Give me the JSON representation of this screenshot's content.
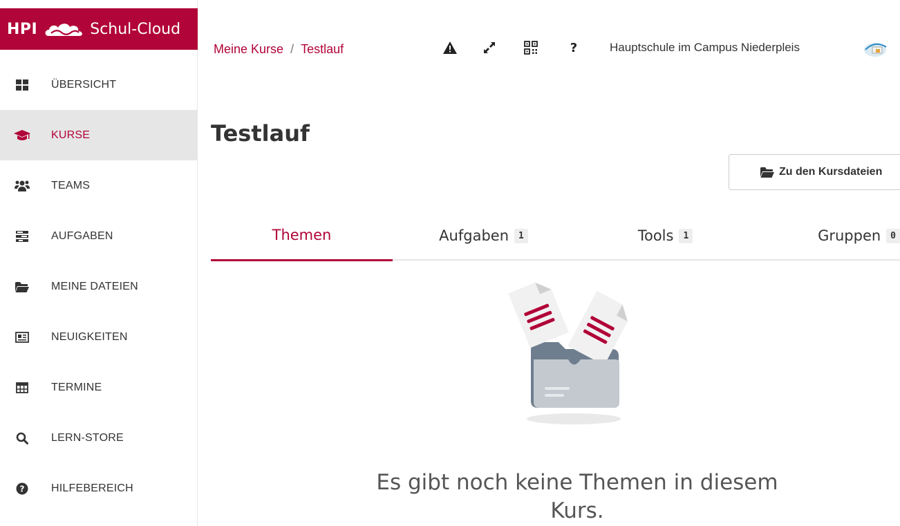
{
  "logo": {
    "hpi": "HPI",
    "brand": "Schul-Cloud"
  },
  "sidebar": {
    "items": [
      {
        "label": "ÜBERSICHT",
        "icon": "dashboard-icon"
      },
      {
        "label": "KURSE",
        "icon": "graduation-cap-icon",
        "active": true
      },
      {
        "label": "TEAMS",
        "icon": "users-icon"
      },
      {
        "label": "AUFGABEN",
        "icon": "tasks-icon"
      },
      {
        "label": "MEINE DATEIEN",
        "icon": "folder-open-icon"
      },
      {
        "label": "NEUIGKEITEN",
        "icon": "newspaper-icon"
      },
      {
        "label": "TERMINE",
        "icon": "calendar-table-icon"
      },
      {
        "label": "LERN-STORE",
        "icon": "search-icon"
      },
      {
        "label": "HILFEBEREICH",
        "icon": "question-circle-icon"
      }
    ]
  },
  "breadcrumb": {
    "parent": "Meine Kurse",
    "separator": "/",
    "current": "Testlauf"
  },
  "topbar": {
    "school_name": "Hauptschule im Campus Niederpleis",
    "icons": [
      "warning-icon",
      "fullscreen-icon",
      "qr-code-icon",
      "help-icon"
    ]
  },
  "main": {
    "title": "Testlauf",
    "files_button": "Zu den Kursdateien",
    "tabs": [
      {
        "label": "Themen",
        "active": true
      },
      {
        "label": "Aufgaben",
        "count": "1"
      },
      {
        "label": "Tools",
        "count": "1"
      },
      {
        "label": "Gruppen",
        "count": "0"
      }
    ],
    "empty_text": "Es gibt noch keine Themen in diesem Kurs."
  },
  "colors": {
    "accent": "#b10438",
    "active_bg": "#e6e6e6",
    "badge_bg": "#eeeeee"
  }
}
